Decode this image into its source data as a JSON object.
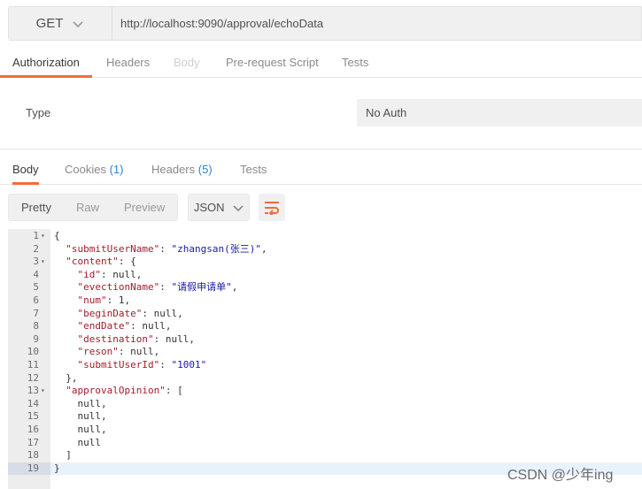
{
  "request": {
    "method": "GET",
    "url": "http://localhost:9090/approval/echoData"
  },
  "request_tabs": [
    {
      "label": "Authorization",
      "state": "active"
    },
    {
      "label": "Headers",
      "state": "normal"
    },
    {
      "label": "Body",
      "state": "disabled"
    },
    {
      "label": "Pre-request Script",
      "state": "normal"
    },
    {
      "label": "Tests",
      "state": "normal"
    }
  ],
  "auth": {
    "type_label": "Type",
    "type_value": "No Auth"
  },
  "response_tabs": [
    {
      "label": "Body",
      "count": "",
      "state": "active"
    },
    {
      "label": "Cookies",
      "count": "(1)",
      "state": "normal"
    },
    {
      "label": "Headers",
      "count": "(5)",
      "state": "normal"
    },
    {
      "label": "Tests",
      "count": "",
      "state": "normal"
    }
  ],
  "response_toolbar": {
    "views": [
      "Pretty",
      "Raw",
      "Preview"
    ],
    "active_view": "Pretty",
    "format": "JSON"
  },
  "editor": {
    "current_line": 19,
    "lines": [
      {
        "n": "1",
        "fold": true,
        "text": "{"
      },
      {
        "n": "2",
        "fold": false,
        "text": "  \"submitUserName\": \"zhangsan(张三)\","
      },
      {
        "n": "3",
        "fold": true,
        "text": "  \"content\": {"
      },
      {
        "n": "4",
        "fold": false,
        "text": "    \"id\": null,"
      },
      {
        "n": "5",
        "fold": false,
        "text": "    \"evectionName\": \"请假申请单\","
      },
      {
        "n": "6",
        "fold": false,
        "text": "    \"num\": 1,"
      },
      {
        "n": "7",
        "fold": false,
        "text": "    \"beginDate\": null,"
      },
      {
        "n": "8",
        "fold": false,
        "text": "    \"endDate\": null,"
      },
      {
        "n": "9",
        "fold": false,
        "text": "    \"destination\": null,"
      },
      {
        "n": "10",
        "fold": false,
        "text": "    \"reson\": null,"
      },
      {
        "n": "11",
        "fold": false,
        "text": "    \"submitUserId\": \"1001\""
      },
      {
        "n": "12",
        "fold": false,
        "text": "  },"
      },
      {
        "n": "13",
        "fold": true,
        "text": "  \"approvalOpinion\": ["
      },
      {
        "n": "14",
        "fold": false,
        "text": "    null,"
      },
      {
        "n": "15",
        "fold": false,
        "text": "    null,"
      },
      {
        "n": "16",
        "fold": false,
        "text": "    null,"
      },
      {
        "n": "17",
        "fold": false,
        "text": "    null"
      },
      {
        "n": "18",
        "fold": false,
        "text": "  ]"
      },
      {
        "n": "19",
        "fold": false,
        "text": "}"
      }
    ]
  },
  "watermark": "CSDN @少年ing",
  "colors": {
    "accent": "#f26b3a",
    "count": "#2f82d4",
    "json_key": "#a11d2b",
    "json_string": "#1a1aa6"
  }
}
